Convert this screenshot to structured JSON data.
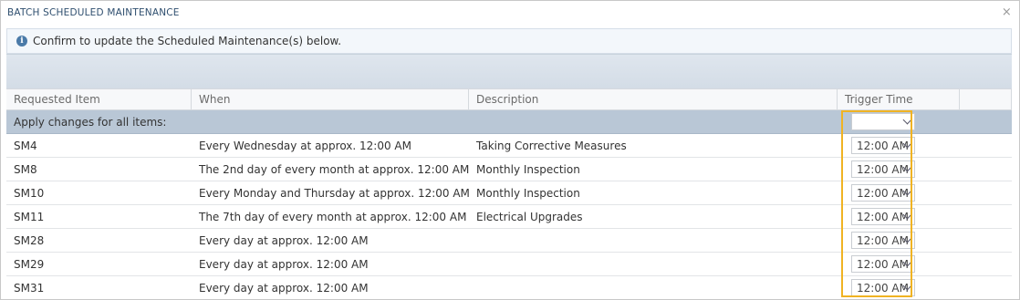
{
  "dialog": {
    "title": "BATCH SCHEDULED MAINTENANCE",
    "close_glyph": "×"
  },
  "info": {
    "message": "Confirm to update the Scheduled Maintenance(s) below."
  },
  "table": {
    "headers": [
      "Requested Item",
      "When",
      "Description",
      "Trigger Time"
    ],
    "apply_all_label": "Apply changes for all items:",
    "apply_all_value": "",
    "rows": [
      {
        "item": "SM4",
        "when": "Every Wednesday at approx. 12:00 AM",
        "description": "Taking Corrective Measures",
        "trigger": "12:00 AM"
      },
      {
        "item": "SM8",
        "when": "The 2nd day of every month at approx. 12:00 AM",
        "description": "Monthly Inspection",
        "trigger": "12:00 AM"
      },
      {
        "item": "SM10",
        "when": "Every Monday and Thursday at approx. 12:00 AM",
        "description": "Monthly Inspection",
        "trigger": "12:00 AM"
      },
      {
        "item": "SM11",
        "when": "The 7th day of every month at approx. 12:00 AM",
        "description": "Electrical Upgrades",
        "trigger": "12:00 AM"
      },
      {
        "item": "SM28",
        "when": "Every day at approx. 12:00 AM",
        "description": "",
        "trigger": "12:00 AM"
      },
      {
        "item": "SM29",
        "when": "Every day at approx. 12:00 AM",
        "description": "",
        "trigger": "12:00 AM"
      },
      {
        "item": "SM31",
        "when": "Every day at approx. 12:00 AM",
        "description": "",
        "trigger": "12:00 AM"
      }
    ]
  },
  "colors": {
    "highlight": "#f0b323",
    "accent": "#4a7aa8"
  }
}
